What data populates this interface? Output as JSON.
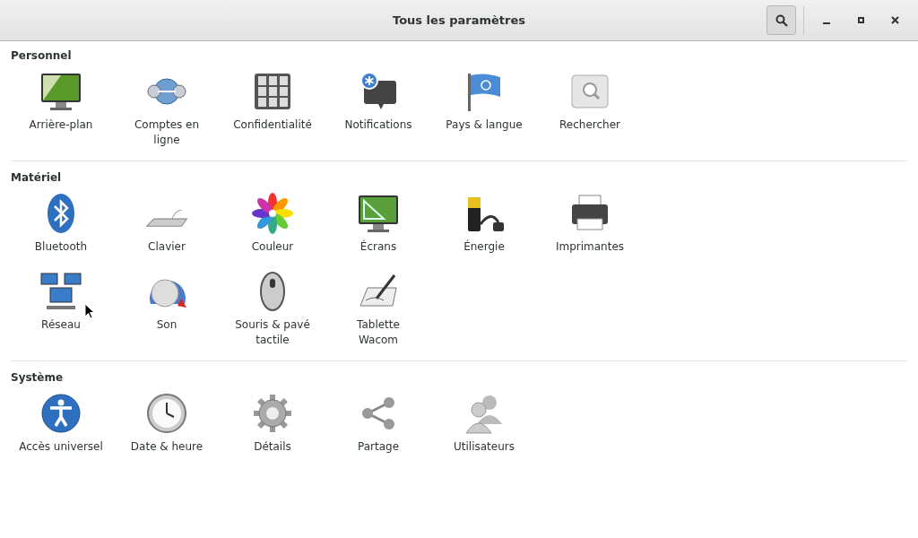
{
  "window": {
    "title": "Tous les paramètres"
  },
  "sections": [
    {
      "heading": "Personnel",
      "items": [
        {
          "label": "Arrière-plan"
        },
        {
          "label": "Comptes en ligne"
        },
        {
          "label": "Confidentialité"
        },
        {
          "label": "Notifications"
        },
        {
          "label": "Pays & langue"
        },
        {
          "label": "Rechercher"
        }
      ]
    },
    {
      "heading": "Matériel",
      "items": [
        {
          "label": "Bluetooth"
        },
        {
          "label": "Clavier"
        },
        {
          "label": "Couleur"
        },
        {
          "label": "Écrans"
        },
        {
          "label": "Énergie"
        },
        {
          "label": "Imprimantes"
        },
        {
          "label": "Réseau"
        },
        {
          "label": "Son"
        },
        {
          "label": "Souris & pavé tactile"
        },
        {
          "label": "Tablette Wacom"
        }
      ]
    },
    {
      "heading": "Système",
      "items": [
        {
          "label": "Accès universel"
        },
        {
          "label": "Date & heure"
        },
        {
          "label": "Détails"
        },
        {
          "label": "Partage"
        },
        {
          "label": "Utilisateurs"
        }
      ]
    }
  ]
}
